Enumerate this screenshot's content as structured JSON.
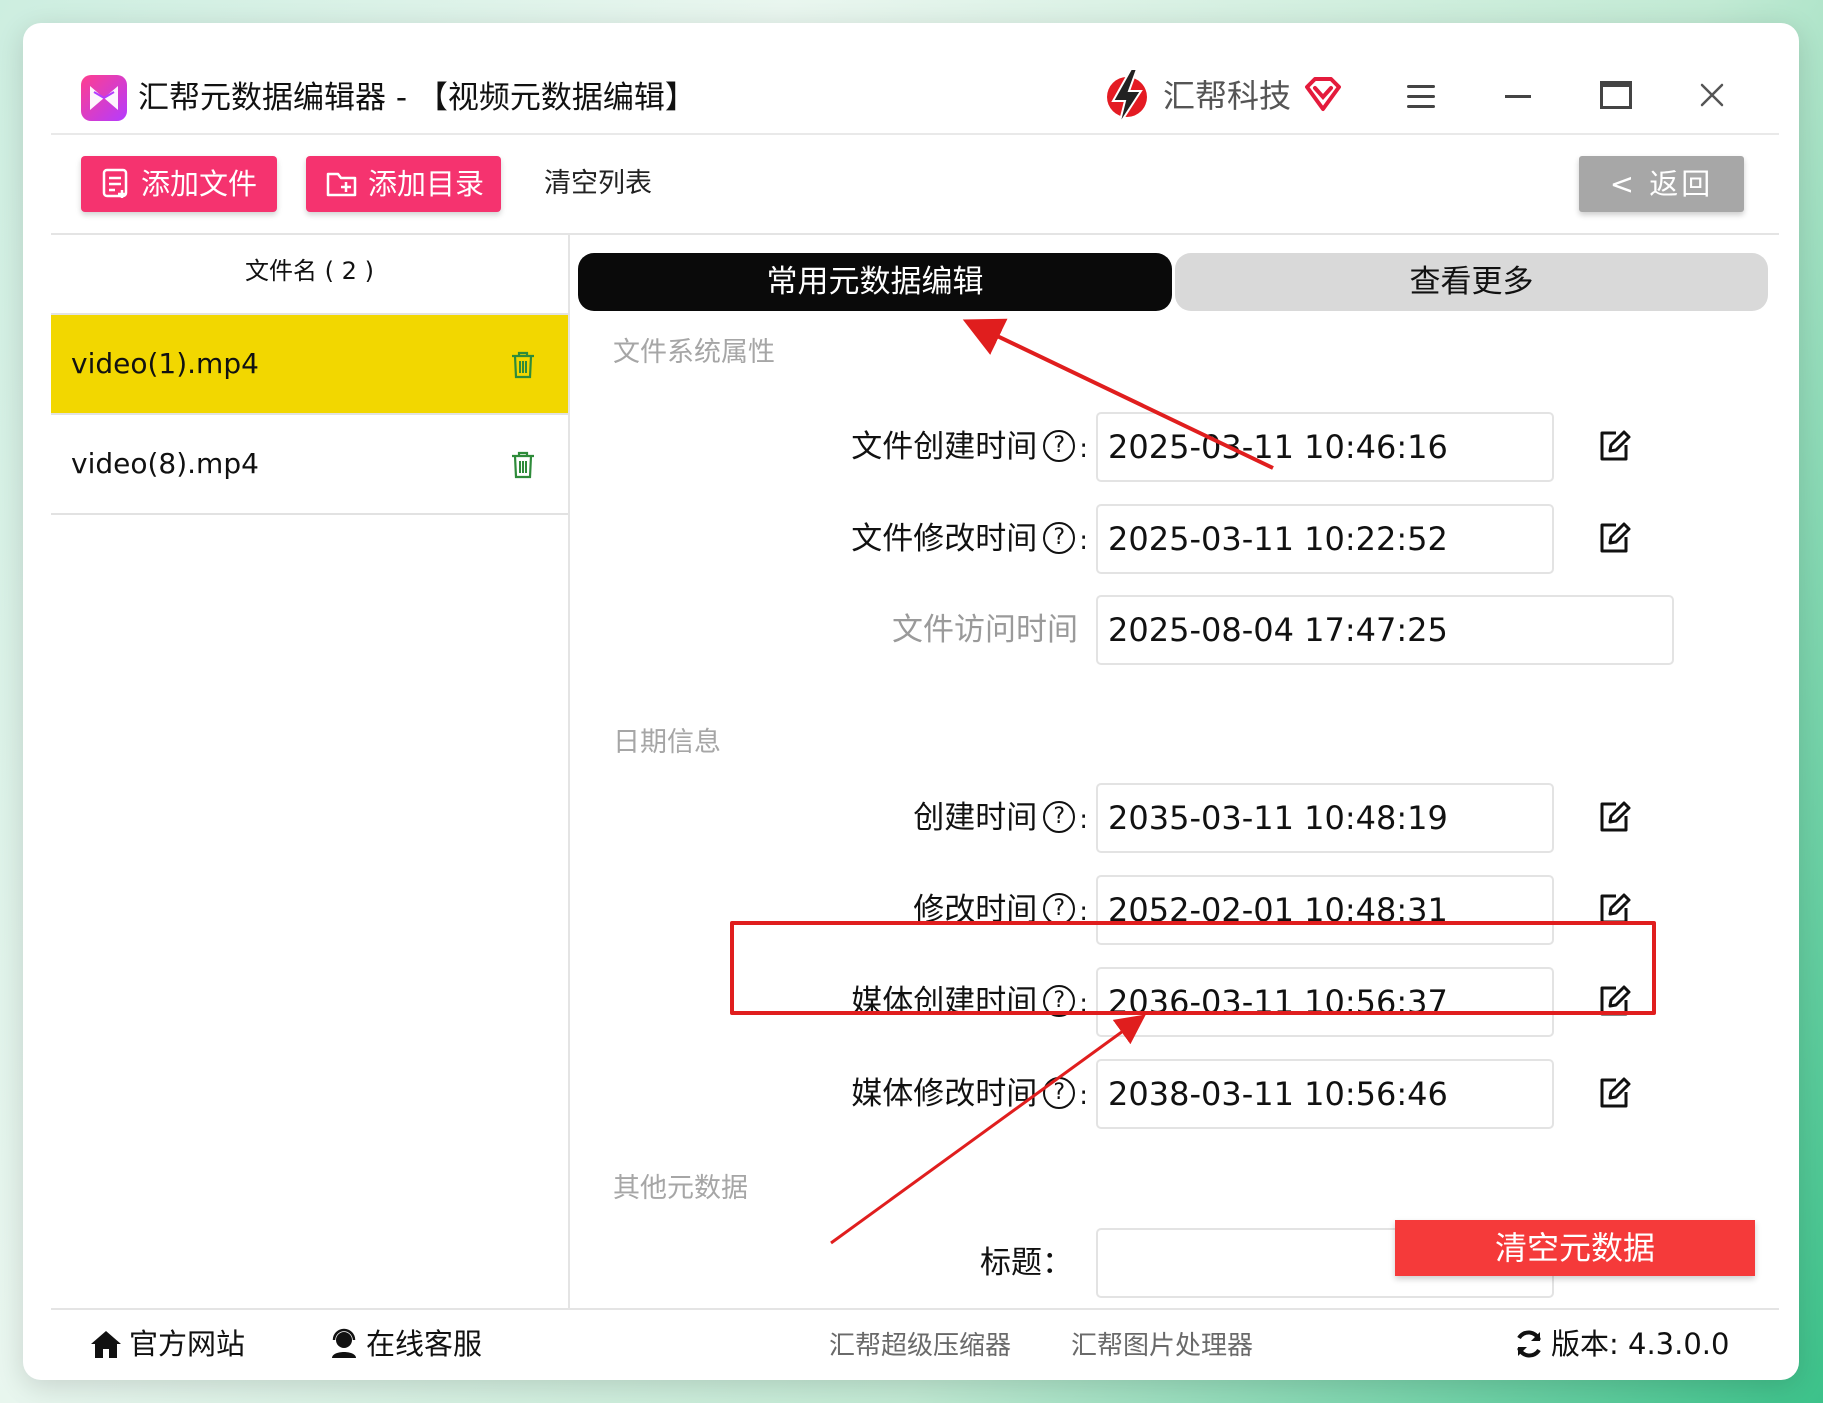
{
  "window": {
    "title": "汇帮元数据编辑器 - 【视频元数据编辑】",
    "brand": "汇帮科技"
  },
  "toolbar": {
    "add_file_label": "添加文件",
    "add_dir_label": "添加目录",
    "clear_list_label": "清空列表",
    "back_label": "< 返回"
  },
  "file_list": {
    "header": "文件名 ( 2 )",
    "files": [
      {
        "name": "video(1).mp4",
        "selected": true
      },
      {
        "name": "video(8).mp4",
        "selected": false
      }
    ]
  },
  "tabs": {
    "common": "常用元数据编辑",
    "more": "查看更多"
  },
  "sections": {
    "filesystem": "文件系统属性",
    "date": "日期信息",
    "other": "其他元数据"
  },
  "fields": {
    "file_created": {
      "label": "文件创建时间",
      "value": "2025-03-11 10:46:16"
    },
    "file_modified": {
      "label": "文件修改时间",
      "value": "2025-03-11 10:22:52"
    },
    "file_accessed": {
      "label": "文件访问时间",
      "value": "2025-08-04 17:47:25"
    },
    "created": {
      "label": "创建时间",
      "value": "2035-03-11 10:48:19"
    },
    "modified": {
      "label": "修改时间",
      "value": "2052-02-01 10:48:31"
    },
    "media_created": {
      "label": "媒体创建时间",
      "value": "2036-03-11 10:56:37"
    },
    "media_modified": {
      "label": "媒体修改时间",
      "value": "2038-03-11 10:56:46"
    },
    "title": {
      "label": "标题：",
      "value": ""
    }
  },
  "help_glyph": "?",
  "colon": ":",
  "clear_metadata_label": "清空元数据",
  "footer": {
    "website": "官方网站",
    "support": "在线客服",
    "compressor": "汇帮超级压缩器",
    "image_processor": "汇帮图片处理器",
    "version": "版本:  4.3.0.0"
  },
  "colors": {
    "accent_pink": "#f5336f",
    "selected_row": "#f2d700",
    "annotation_red": "#e01e1e",
    "clear_button": "#f53a3a"
  }
}
